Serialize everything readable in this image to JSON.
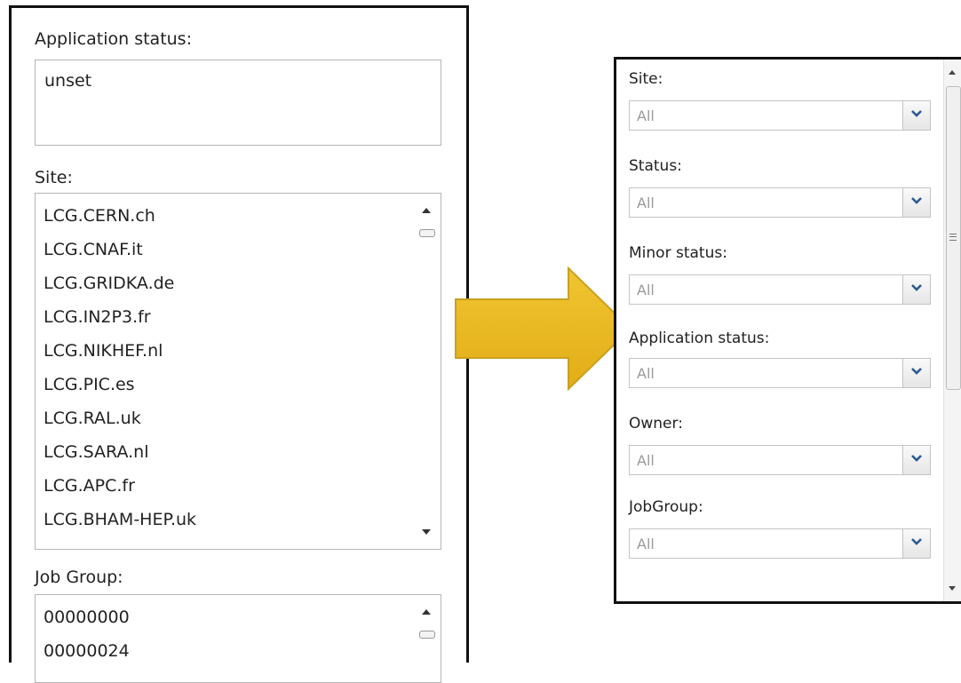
{
  "left": {
    "application_status": {
      "label": "Application status:",
      "value": "unset"
    },
    "site": {
      "label": "Site:",
      "items": [
        "LCG.CERN.ch",
        "LCG.CNAF.it",
        "LCG.GRIDKA.de",
        "LCG.IN2P3.fr",
        "LCG.NIKHEF.nl",
        "LCG.PIC.es",
        "LCG.RAL.uk",
        "LCG.SARA.nl",
        "LCG.APC.fr",
        "LCG.BHAM-HEP.uk"
      ]
    },
    "job_group": {
      "label": "Job Group:",
      "items": [
        "00000000",
        "00000024"
      ]
    }
  },
  "right": {
    "filters": [
      {
        "label": "Site:",
        "value": "All"
      },
      {
        "label": "Status:",
        "value": "All"
      },
      {
        "label": "Minor status:",
        "value": "All"
      },
      {
        "label": "Application status:",
        "value": "All"
      },
      {
        "label": "Owner:",
        "value": "All"
      },
      {
        "label": "JobGroup:",
        "value": "All"
      }
    ]
  },
  "colors": {
    "arrow": "#e8b923",
    "arrow_stroke": "#c9a020"
  }
}
